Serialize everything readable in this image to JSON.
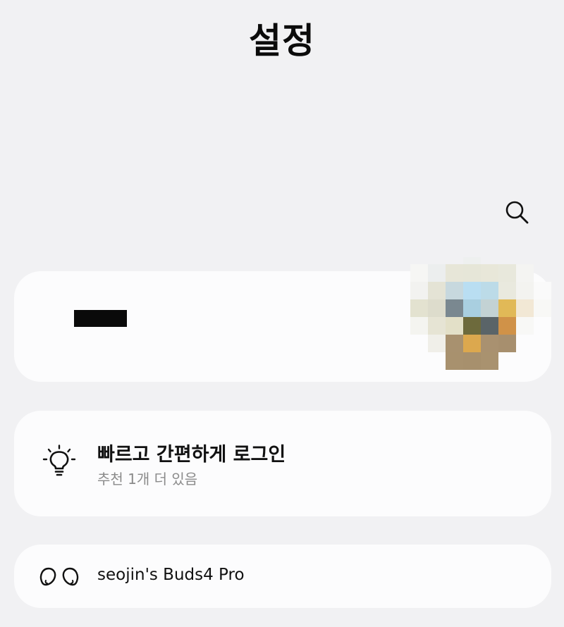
{
  "header": {
    "title": "설정"
  },
  "toolbar": {
    "search_icon": "search-icon"
  },
  "profile": {
    "name_redacted": true,
    "avatar": "pixelated-avatar"
  },
  "login_suggestion": {
    "icon": "lightbulb-icon",
    "title": "빠르고 간편하게 로그인",
    "subtitle": "추천 1개 더 있음"
  },
  "connected_device": {
    "icon": "earbuds-icon",
    "label": "seojin's Buds4 Pro"
  },
  "colors": {
    "background": "#f1f1f3",
    "card": "#fcfcfd",
    "subtitle": "#8a8a8a"
  }
}
